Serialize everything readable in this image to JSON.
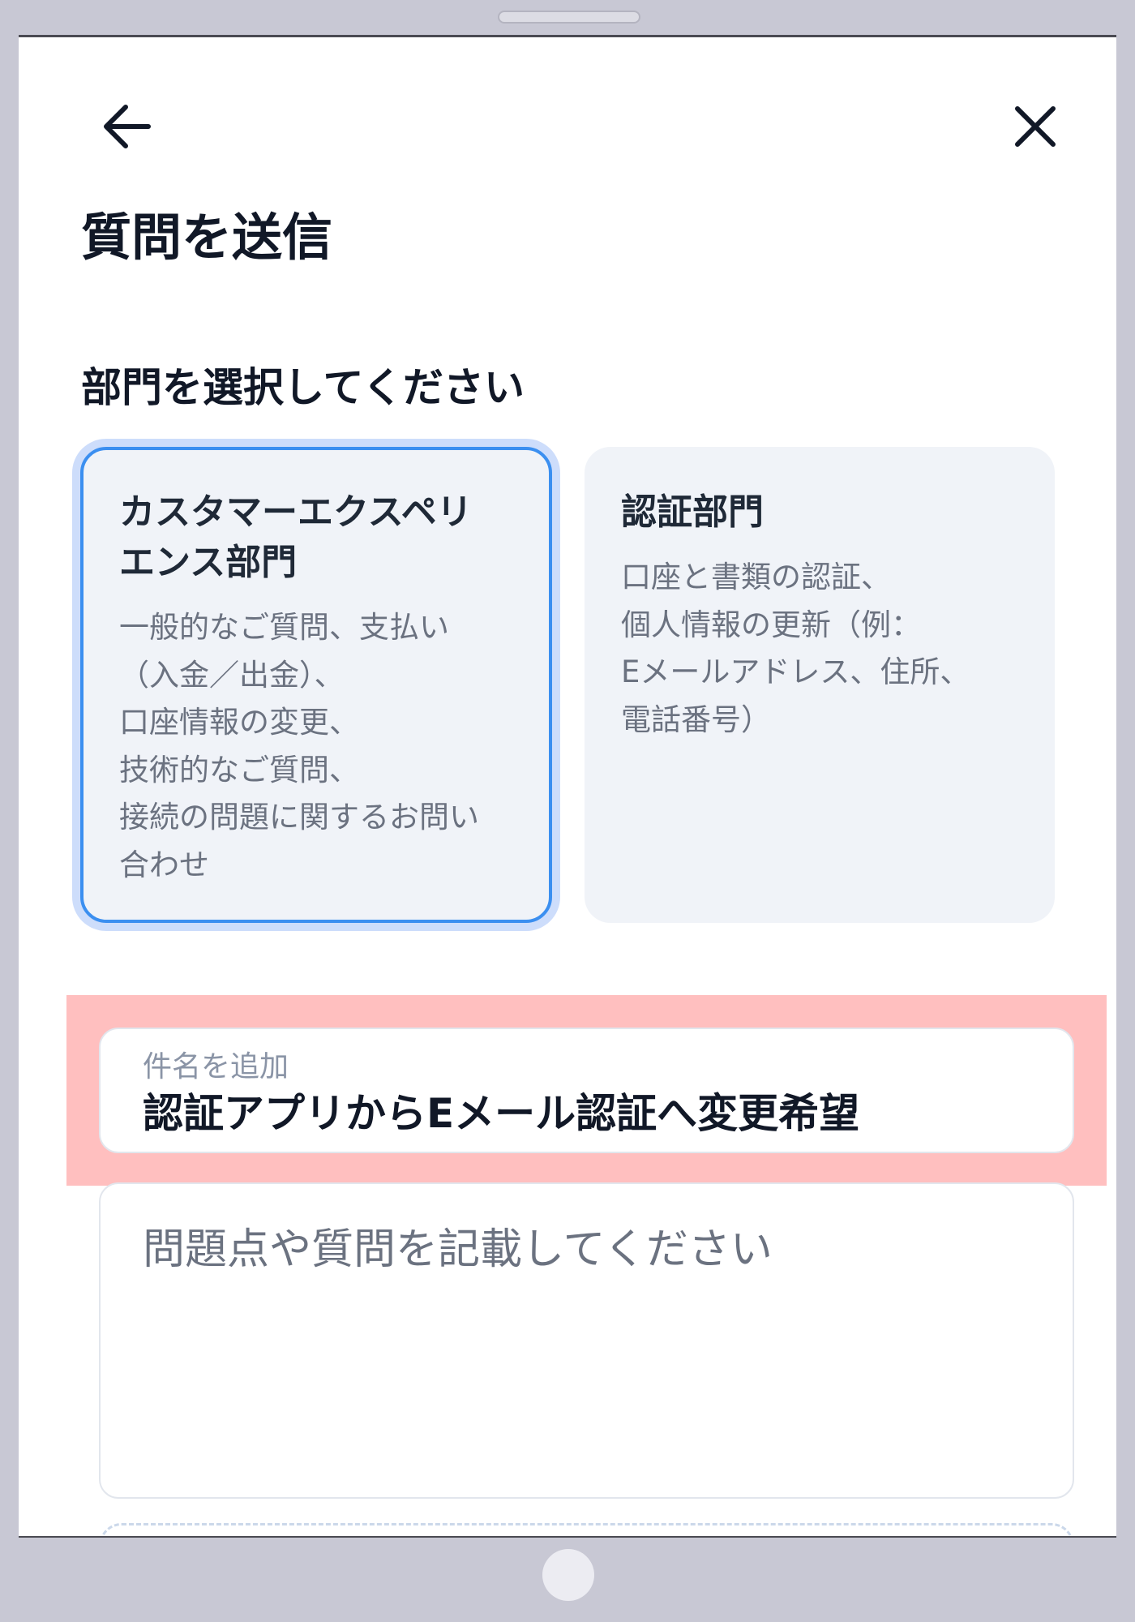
{
  "header": {
    "back_icon": "arrow-left-icon",
    "close_icon": "close-icon",
    "title": "質問を送信"
  },
  "department": {
    "label": "部門を選択してください",
    "options": [
      {
        "title_lines": [
          "カスタマーエクスペリ",
          "エンス部門"
        ],
        "description_lines": [
          "一般的なご質問、支払い",
          "（入金／出金）、",
          "口座情報の変更、",
          "技術的なご質問、",
          "接続の問題に関するお問い",
          "合わせ"
        ],
        "selected": true
      },
      {
        "title_lines": [
          "認証部門"
        ],
        "description_lines": [
          "口座と書類の認証、",
          "個人情報の更新（例：",
          "Eメールアドレス、住所、",
          "電話番号）"
        ],
        "selected": false
      }
    ]
  },
  "subject": {
    "label": "件名を追加",
    "value": "認証アプリからEメール認証へ変更希望"
  },
  "message": {
    "placeholder": "問題点や質問を記載してください"
  },
  "colors": {
    "accent": "#3b8ff0",
    "highlight": "#ffbfbf",
    "card_bg": "#f0f3f8"
  }
}
